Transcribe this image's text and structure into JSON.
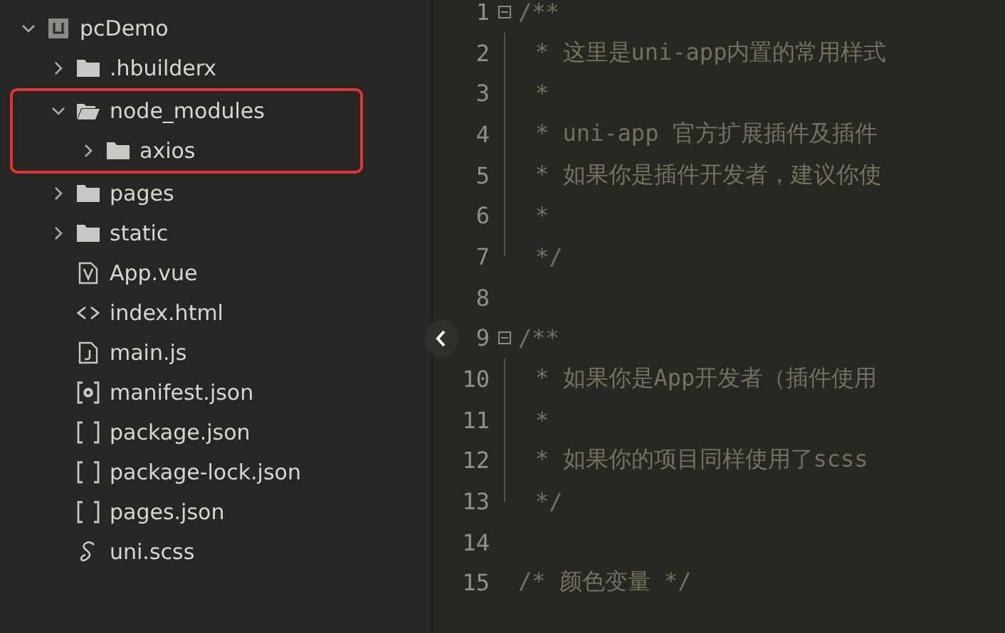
{
  "project": {
    "name": "pcDemo",
    "expanded": true,
    "children": [
      {
        "name": ".hbuilderx",
        "kind": "folder",
        "expanded": false
      },
      {
        "name": "node_modules",
        "kind": "folder",
        "expanded": true,
        "highlighted": true,
        "children": [
          {
            "name": "axios",
            "kind": "folder",
            "expanded": false
          }
        ]
      },
      {
        "name": "pages",
        "kind": "folder",
        "expanded": false
      },
      {
        "name": "static",
        "kind": "folder",
        "expanded": false
      },
      {
        "name": "App.vue",
        "kind": "vue"
      },
      {
        "name": "index.html",
        "kind": "html"
      },
      {
        "name": "main.js",
        "kind": "js"
      },
      {
        "name": "manifest.json",
        "kind": "manifest"
      },
      {
        "name": "package.json",
        "kind": "json"
      },
      {
        "name": "package-lock.json",
        "kind": "json"
      },
      {
        "name": "pages.json",
        "kind": "json"
      },
      {
        "name": "uni.scss",
        "kind": "scss"
      }
    ]
  },
  "editor": {
    "lines": [
      {
        "number": "1",
        "text": "/**",
        "kind": "foldstart"
      },
      {
        "number": "2",
        "text": "* 这里是uni-app内置的常用样式",
        "kind": "block"
      },
      {
        "number": "3",
        "text": "*",
        "kind": "block"
      },
      {
        "number": "4",
        "text": "* uni-app 官方扩展插件及插件",
        "kind": "block"
      },
      {
        "number": "5",
        "text": "* 如果你是插件开发者，建议你使",
        "kind": "block"
      },
      {
        "number": "6",
        "text": "*",
        "kind": "block"
      },
      {
        "number": "7",
        "text": "*/",
        "kind": "blockend"
      },
      {
        "number": "8",
        "kind": "plain"
      },
      {
        "number": "9",
        "text": "/**",
        "kind": "foldstart"
      },
      {
        "number": "10",
        "text": "* 如果你是App开发者（插件使用",
        "kind": "block"
      },
      {
        "number": "11",
        "text": "*",
        "kind": "block"
      },
      {
        "number": "12",
        "text": "* 如果你的项目同样使用了scss",
        "kind": "block"
      },
      {
        "number": "13",
        "text": "*/",
        "kind": "blockend"
      },
      {
        "number": "14",
        "kind": "plain"
      },
      {
        "number": "15",
        "text": "/* 颜色变量 */",
        "kind": "plain"
      }
    ]
  }
}
